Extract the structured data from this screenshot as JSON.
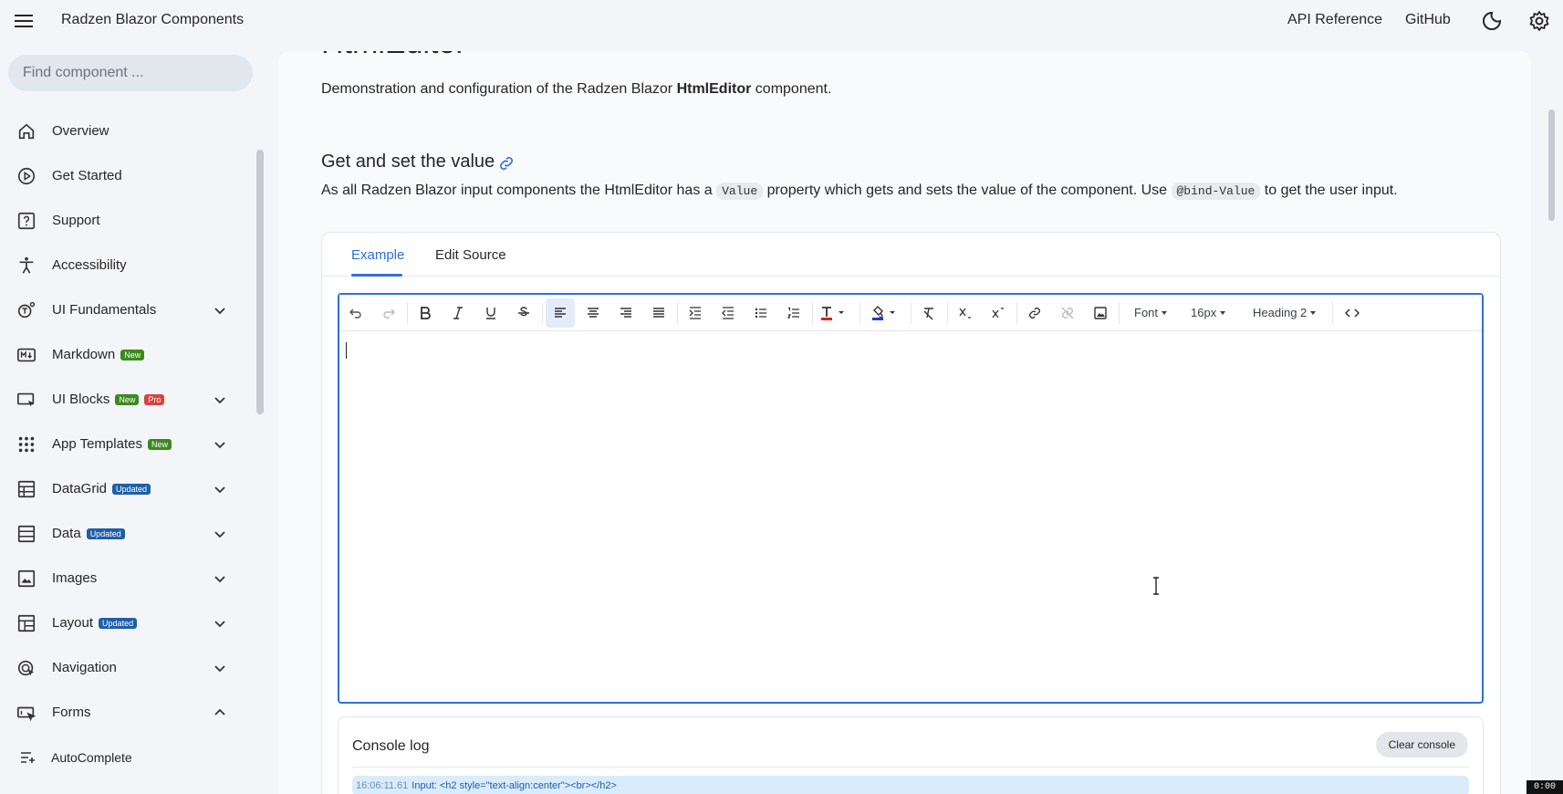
{
  "header": {
    "app_title": "Radzen Blazor Components",
    "links": [
      "API Reference",
      "GitHub"
    ]
  },
  "sidebar": {
    "search_placeholder": "Find component ...",
    "items": [
      {
        "label": "Overview",
        "icon": "home-icon"
      },
      {
        "label": "Get Started",
        "icon": "play-circle-icon"
      },
      {
        "label": "Support",
        "icon": "help-box-icon"
      },
      {
        "label": "Accessibility",
        "icon": "accessibility-icon"
      },
      {
        "label": "UI Fundamentals",
        "icon": "ui-fundamentals-icon",
        "expandable": true
      },
      {
        "label": "Markdown",
        "icon": "markdown-icon",
        "badges": [
          "New"
        ]
      },
      {
        "label": "UI Blocks",
        "icon": "ui-blocks-icon",
        "badges": [
          "New",
          "Pro"
        ],
        "expandable": true
      },
      {
        "label": "App Templates",
        "icon": "apps-grid-icon",
        "badges": [
          "New"
        ],
        "expandable": true
      },
      {
        "label": "DataGrid",
        "icon": "table-icon",
        "badges": [
          "Updated"
        ],
        "expandable": true
      },
      {
        "label": "Data",
        "icon": "list-icon",
        "badges": [
          "Updated"
        ],
        "expandable": true
      },
      {
        "label": "Images",
        "icon": "images-icon",
        "expandable": true
      },
      {
        "label": "Layout",
        "icon": "layout-icon",
        "badges": [
          "Updated"
        ],
        "expandable": true
      },
      {
        "label": "Navigation",
        "icon": "navigation-icon",
        "expandable": true
      },
      {
        "label": "Forms",
        "icon": "forms-icon",
        "expandable": true,
        "expanded": true
      }
    ],
    "sub_items": [
      {
        "label": "AutoComplete",
        "icon": "autocomplete-icon"
      }
    ]
  },
  "main": {
    "page_title": "HtmlEditor",
    "description_pre": "Demonstration and configuration of the Radzen Blazor ",
    "description_bold": "HtmlEditor",
    "description_post": " component.",
    "section_title": "Get and set the value",
    "section_text_1": "As all Radzen Blazor input components the HtmlEditor has a ",
    "code_1": "Value",
    "section_text_2": " property which gets and sets the value of the component. Use ",
    "code_2": "@bind-Value",
    "section_text_3": " to get the user input.",
    "tabs": [
      "Example",
      "Edit Source"
    ],
    "active_tab": "Example"
  },
  "editor": {
    "toolbar": {
      "font_label": "Font",
      "size_label": "16px",
      "format_label": "Heading 2",
      "active_tool": "align-left",
      "text_color": "#e02020",
      "highlight_color": "#1f3ccf"
    }
  },
  "console": {
    "title": "Console log",
    "clear_label": "Clear console",
    "entries": [
      {
        "time": "16:06:11.61",
        "text": "Input: <h2 style=\"text-align:center\"><br></h2>"
      }
    ]
  },
  "corner_badge": "0:00"
}
